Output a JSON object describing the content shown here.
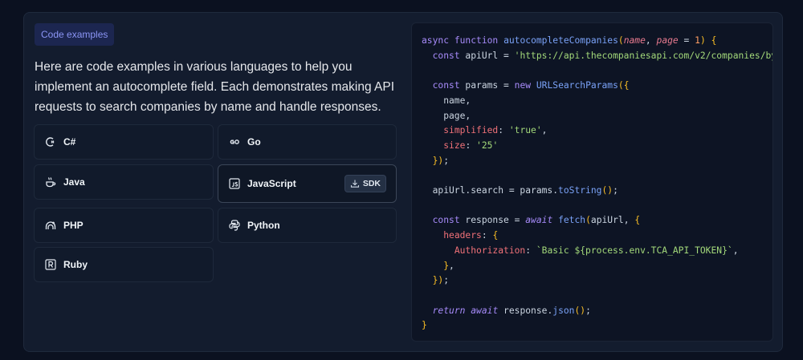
{
  "badge": "Code examples",
  "intro": "Here are code examples in various languages to help you implement an autocomplete field. Each demonstrates making API requests to search companies by name and handle responses.",
  "languages": [
    {
      "label": "C#",
      "icon": "csharp-icon"
    },
    {
      "label": "Go",
      "icon": "go-icon"
    },
    {
      "label": "Java",
      "icon": "java-icon"
    },
    {
      "label": "JavaScript",
      "icon": "javascript-icon",
      "active": true,
      "sdk_label": "SDK"
    },
    {
      "label": "PHP",
      "icon": "php-icon"
    },
    {
      "label": "Python",
      "icon": "python-icon"
    },
    {
      "label": "Ruby",
      "icon": "ruby-icon"
    }
  ],
  "code": {
    "fn_name": "autocompleteCompanies",
    "api_url": "'https://api.thecompaniesapi.com/v2/companies/by-na",
    "simplified_value": "'true'",
    "size_value": "'25'",
    "auth_value": "`Basic ${process.env.TCA_API_TOKEN}`"
  },
  "colors": {
    "background": "#0b1120",
    "panel": "#131c2e",
    "badge_text": "#8b95f5",
    "keyword": "#a78bfa",
    "function": "#7aa2f7",
    "string": "#a3d97a",
    "number": "#ff9e64"
  }
}
